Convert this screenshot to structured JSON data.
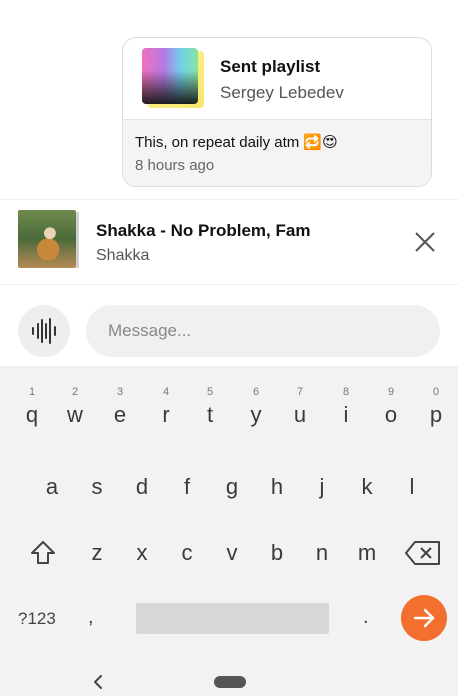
{
  "message": {
    "playlist_title": "Sent playlist",
    "playlist_user": "Sergey Lebedev",
    "text": "This, on repeat daily atm 🔁😍",
    "time": "8 hours ago"
  },
  "now_playing": {
    "title": "Shakka - No Problem, Fam",
    "artist": "Shakka"
  },
  "composer": {
    "placeholder": "Message..."
  },
  "keyboard": {
    "row1": [
      {
        "num": "1",
        "ch": "q"
      },
      {
        "num": "2",
        "ch": "w"
      },
      {
        "num": "3",
        "ch": "e"
      },
      {
        "num": "4",
        "ch": "r"
      },
      {
        "num": "5",
        "ch": "t"
      },
      {
        "num": "6",
        "ch": "y"
      },
      {
        "num": "7",
        "ch": "u"
      },
      {
        "num": "8",
        "ch": "i"
      },
      {
        "num": "9",
        "ch": "o"
      },
      {
        "num": "0",
        "ch": "p"
      }
    ],
    "row2": [
      "a",
      "s",
      "d",
      "f",
      "g",
      "h",
      "j",
      "k",
      "l"
    ],
    "row3": [
      "z",
      "x",
      "c",
      "v",
      "b",
      "n",
      "m"
    ],
    "sym_label": "?123",
    "comma": ",",
    "period": "."
  },
  "colors": {
    "accent": "#f26f2d",
    "keyboard_bg": "#f2f2f2"
  }
}
